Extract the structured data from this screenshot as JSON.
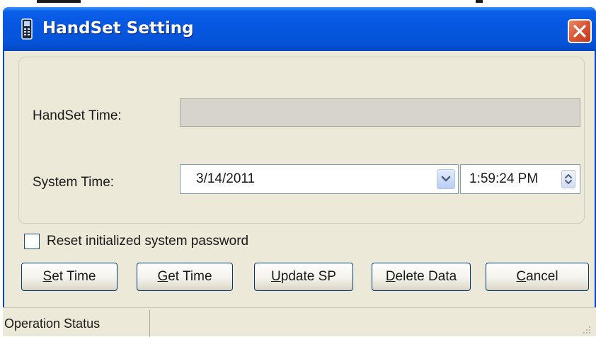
{
  "window": {
    "title": "HandSet Setting"
  },
  "fields": {
    "handset_time_label": "HandSet Time:",
    "handset_time_value": "",
    "system_time_label": "System Time:",
    "system_date_value": "3/14/2011",
    "system_time_value": "1:59:24 PM"
  },
  "options": {
    "reset_password_label": "Reset initialized system password",
    "reset_password_checked": false
  },
  "buttons": {
    "set_time": {
      "mnemonic": "S",
      "rest": "et Time"
    },
    "get_time": {
      "mnemonic": "G",
      "rest": "et Time"
    },
    "update_sp": {
      "mnemonic": "U",
      "rest": "pdate SP"
    },
    "delete_data": {
      "mnemonic": "D",
      "rest": "elete Data"
    },
    "cancel": {
      "mnemonic": "C",
      "rest": "ancel"
    }
  },
  "statusbar": {
    "text": "Operation Status"
  },
  "colors": {
    "titlebar": "#0554D8",
    "window_bg": "#ECE9D8",
    "close_button": "#D85534",
    "button_border": "#003C74"
  },
  "icons": {
    "title": "handset-icon",
    "close": "close-icon",
    "dropdown": "chevron-down-icon",
    "spinner": "spinner-arrows-icon",
    "grip": "resize-grip-icon"
  }
}
